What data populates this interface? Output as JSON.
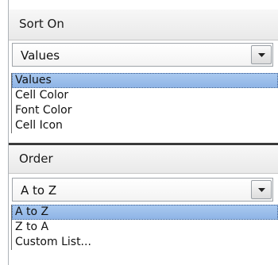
{
  "sort_on": {
    "header_label": "Sort On",
    "selected_value": "Values",
    "dropdown_button_icon": "dropdown-arrow",
    "options": [
      "Values",
      "Cell Color",
      "Font Color",
      "Cell Icon"
    ]
  },
  "order": {
    "header_label": "Order",
    "selected_value": "A to Z",
    "dropdown_button_icon": "dropdown-arrow",
    "options": [
      "A to Z",
      "Z to A",
      "Custom List..."
    ]
  },
  "colors": {
    "selection": "#9bbdeb",
    "selection_border": "#3c5f90",
    "header_bg": "#efefef"
  }
}
